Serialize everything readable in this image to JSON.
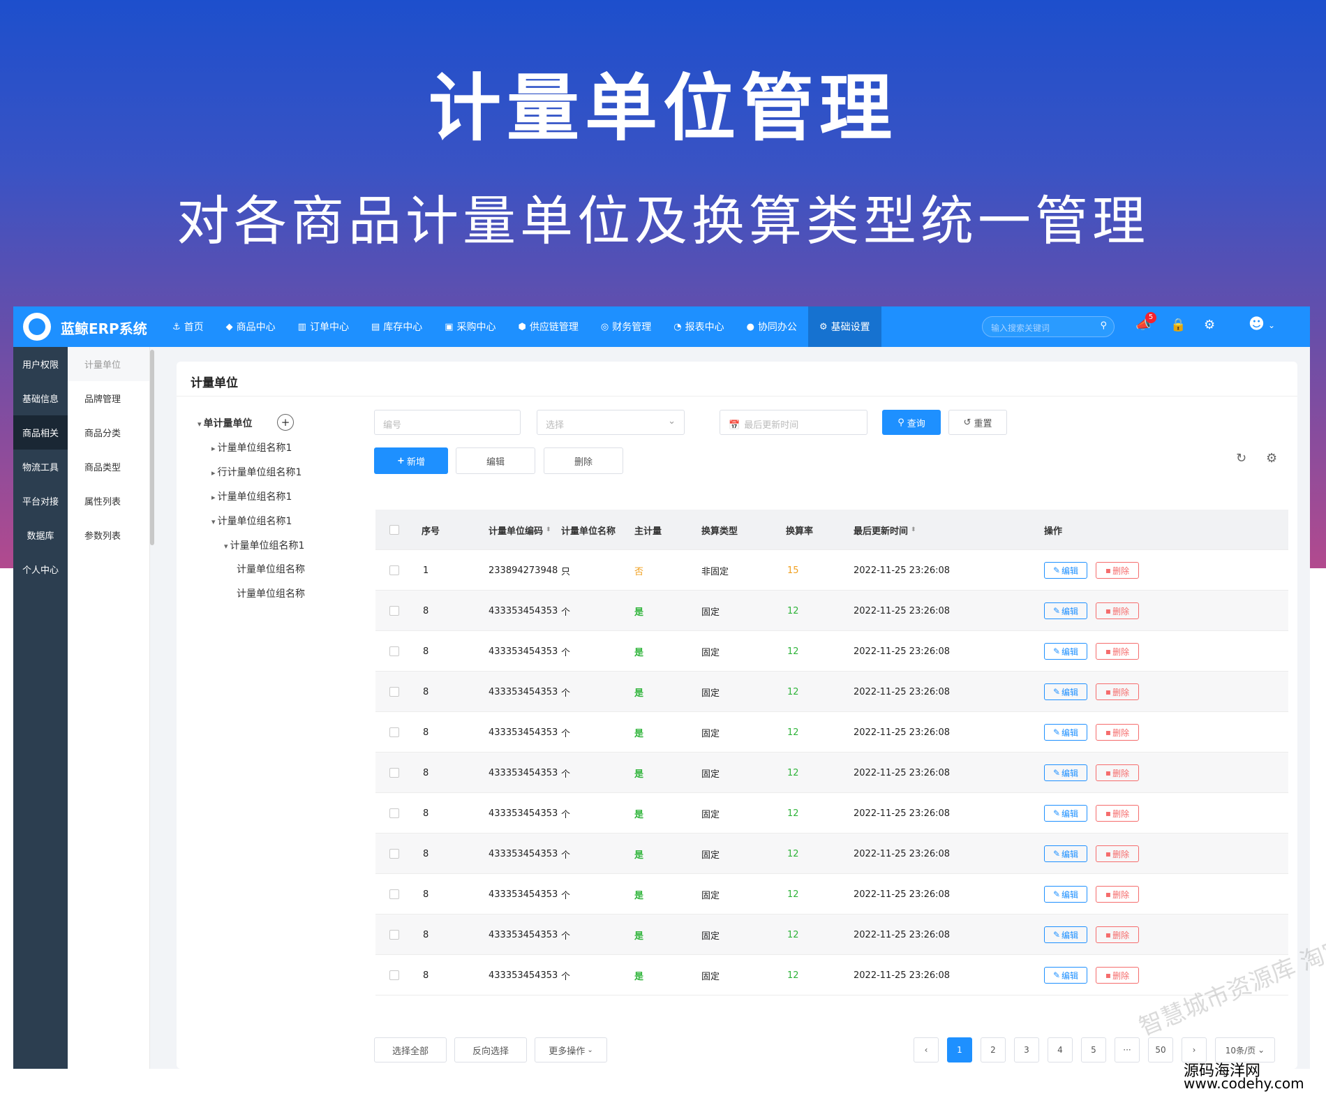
{
  "hero": {
    "title": "计量单位管理",
    "subtitle": "对各商品计量单位及换算类型统一管理"
  },
  "topbar": {
    "brand": "蓝鲸ERP系统",
    "nav": [
      {
        "label": "首页",
        "icon": "anchor-icon"
      },
      {
        "label": "商品中心",
        "icon": "diamond-icon"
      },
      {
        "label": "订单中心",
        "icon": "bar-chart-icon"
      },
      {
        "label": "库存中心",
        "icon": "database-icon"
      },
      {
        "label": "采购中心",
        "icon": "cart-icon"
      },
      {
        "label": "供应链管理",
        "icon": "cubes-icon"
      },
      {
        "label": "财务管理",
        "icon": "target-icon"
      },
      {
        "label": "报表中心",
        "icon": "dashboard-icon"
      },
      {
        "label": "协同办公",
        "icon": "comments-icon"
      },
      {
        "label": "基础设置",
        "icon": "cogs-icon"
      }
    ],
    "search_placeholder": "输入搜索关键词",
    "notify_count": "5"
  },
  "sidebar_primary": [
    "用户权限",
    "基础信息",
    "商品相关",
    "物流工具",
    "平台对接",
    "数据库",
    "个人中心"
  ],
  "sidebar_secondary": [
    "计量单位",
    "品牌管理",
    "商品分类",
    "商品类型",
    "属性列表",
    "参数列表"
  ],
  "panel": {
    "title": "计量单位"
  },
  "tree": [
    "单计量单位",
    "计量单位组名称1",
    "行计量单位组名称1",
    "计量单位组名称1",
    "计量单位组名称1",
    "计量单位组名称1",
    "计量单位组名称",
    "计量单位组名称"
  ],
  "filters": {
    "code_placeholder": "编号",
    "select_placeholder": "选择",
    "date_placeholder": "最后更新时间",
    "query_label": "查询",
    "reset_label": "重置"
  },
  "toolbar": {
    "add_label": "新增",
    "edit_label": "编辑",
    "delete_label": "删除"
  },
  "table": {
    "columns": [
      "序号",
      "计量单位编码",
      "计量单位名称",
      "主计量",
      "换算类型",
      "换算率",
      "最后更新时间",
      "操作"
    ],
    "rows": [
      {
        "no": "1",
        "code": "233894273948",
        "name": "只",
        "main": "否",
        "type": "非固定",
        "rate": "15",
        "time": "2022-11-25 23:26:08"
      },
      {
        "no": "8",
        "code": "433353454353",
        "name": "个",
        "main": "是",
        "type": "固定",
        "rate": "12",
        "time": "2022-11-25 23:26:08"
      },
      {
        "no": "8",
        "code": "433353454353",
        "name": "个",
        "main": "是",
        "type": "固定",
        "rate": "12",
        "time": "2022-11-25 23:26:08"
      },
      {
        "no": "8",
        "code": "433353454353",
        "name": "个",
        "main": "是",
        "type": "固定",
        "rate": "12",
        "time": "2022-11-25 23:26:08"
      },
      {
        "no": "8",
        "code": "433353454353",
        "name": "个",
        "main": "是",
        "type": "固定",
        "rate": "12",
        "time": "2022-11-25 23:26:08"
      },
      {
        "no": "8",
        "code": "433353454353",
        "name": "个",
        "main": "是",
        "type": "固定",
        "rate": "12",
        "time": "2022-11-25 23:26:08"
      },
      {
        "no": "8",
        "code": "433353454353",
        "name": "个",
        "main": "是",
        "type": "固定",
        "rate": "12",
        "time": "2022-11-25 23:26:08"
      },
      {
        "no": "8",
        "code": "433353454353",
        "name": "个",
        "main": "是",
        "type": "固定",
        "rate": "12",
        "time": "2022-11-25 23:26:08"
      },
      {
        "no": "8",
        "code": "433353454353",
        "name": "个",
        "main": "是",
        "type": "固定",
        "rate": "12",
        "time": "2022-11-25 23:26:08"
      },
      {
        "no": "8",
        "code": "433353454353",
        "name": "个",
        "main": "是",
        "type": "固定",
        "rate": "12",
        "time": "2022-11-25 23:26:08"
      },
      {
        "no": "8",
        "code": "433353454353",
        "name": "个",
        "main": "是",
        "type": "固定",
        "rate": "12",
        "time": "2022-11-25 23:26:08"
      }
    ],
    "edit_label": "编辑",
    "delete_label": "删除"
  },
  "footer": {
    "select_all": "选择全部",
    "invert": "反向选择",
    "more": "更多操作",
    "pages": [
      "1",
      "2",
      "3",
      "4",
      "5",
      "···",
      "50"
    ],
    "page_size": "10条/页"
  },
  "watermark": "智慧城市资源库 淘宝店",
  "source": {
    "name": "源码海洋网",
    "url": "www.codehy.com"
  },
  "colors": {
    "primary": "#1e90ff",
    "sidebar": "#2c3e50",
    "yes": "#2fb43a",
    "no": "#f0a020",
    "danger": "#f56c6c"
  }
}
